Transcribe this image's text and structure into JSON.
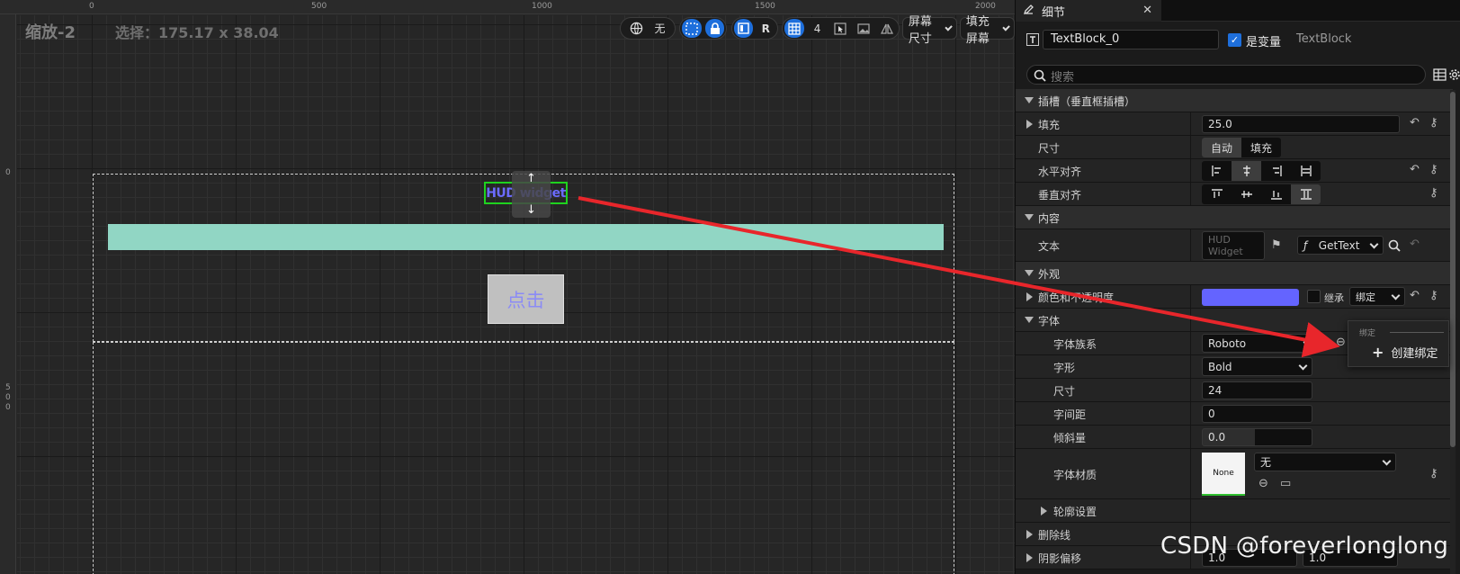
{
  "designer": {
    "zoom": "缩放-2",
    "selection": "选择：175.17 x 38.04",
    "ruler_top_labels": [
      "0",
      "500",
      "1000",
      "1500",
      "2000"
    ],
    "ruler_left_labels": [
      "0",
      "5",
      "0",
      "0"
    ],
    "toolbar": {
      "world_label": "无",
      "r_label": "R",
      "grid_value": "4",
      "screen_size": "屏幕尺寸",
      "fill_screen": "填充屏幕"
    },
    "hud_widget_text": "HUD widget",
    "click_button_label": "点击",
    "bar_color": "#91d6c4",
    "text_color": "#6b6bff"
  },
  "details": {
    "tab_label": "细节",
    "object_name": "TextBlock_0",
    "is_variable_label": "是变量",
    "is_variable_checked": true,
    "class_name": "TextBlock",
    "search_placeholder": "搜索",
    "sections": {
      "slot": "插槽（垂直框插槽）",
      "padding_label": "填充",
      "padding_value": "25.0",
      "size_label": "尺寸",
      "size_auto": "自动",
      "size_fill": "填充",
      "h_align_label": "水平对齐",
      "v_align_label": "垂直对齐",
      "content": "内容",
      "text_label": "文本",
      "text_value": "HUD Widget",
      "bind_function": "GetText",
      "appearance": "外观",
      "color_label": "颜色和不透明度",
      "color_value": "#6464ff",
      "inherit_label": "继承",
      "bind_label": "绑定",
      "font": "字体",
      "font_family_label": "字体族系",
      "font_family_value": "Roboto",
      "typeface_label": "字形",
      "typeface_value": "Bold",
      "font_size_label": "尺寸",
      "font_size_value": "24",
      "letter_spacing_label": "字间距",
      "letter_spacing_value": "0",
      "skew_label": "倾斜量",
      "skew_value": "0.0",
      "font_material_label": "字体材质",
      "font_material_thumb": "None",
      "font_material_value": "无",
      "outline_label": "轮廓设置",
      "strikethrough_label": "删除线",
      "shadow_label": "阴影偏移",
      "shadow_x": "1.0",
      "shadow_y": "1.0"
    },
    "popup": {
      "header": "绑定",
      "create_binding": "创建绑定"
    }
  },
  "watermark": "CSDN @foreverlonglong"
}
